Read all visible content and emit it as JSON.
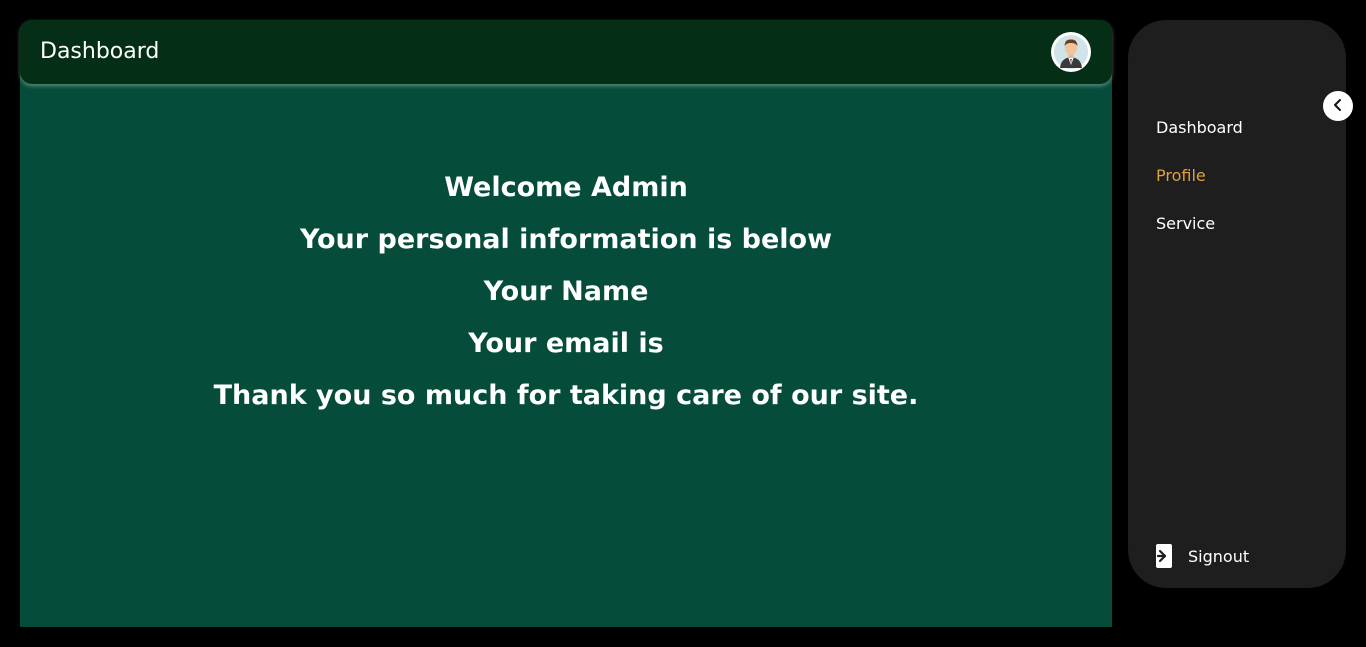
{
  "header": {
    "title": "Dashboard",
    "avatar_icon": "user-avatar-icon"
  },
  "main": {
    "background_color": "#064c3a",
    "lines": [
      "Welcome Admin",
      "Your personal information is below",
      "Your Name",
      "Your email is",
      "Thank you so much for taking care of our site."
    ]
  },
  "sidebar": {
    "collapse_icon": "chevron-left-icon",
    "items": [
      {
        "label": "Dashboard",
        "active": false
      },
      {
        "label": "Profile",
        "active": true
      },
      {
        "label": "Service",
        "active": false
      }
    ],
    "signout": {
      "label": "Signout",
      "icon": "signout-icon"
    },
    "active_color": "#e0a040"
  }
}
